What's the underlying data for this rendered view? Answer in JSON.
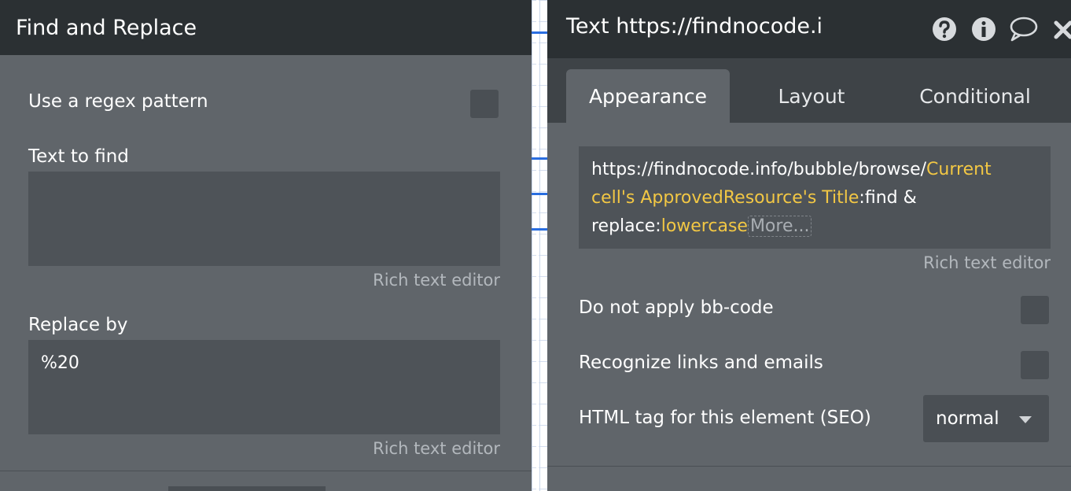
{
  "find_replace": {
    "title": "Find and Replace",
    "use_regex_label": "Use a regex pattern",
    "text_to_find_label": "Text to find",
    "text_to_find_value": "",
    "rich_text_editor_1": "Rich text editor",
    "replace_by_label": "Replace by",
    "replace_by_value": "%20",
    "rich_text_editor_2": "Rich text editor"
  },
  "element_editor": {
    "title": "Text https://findnocode.i",
    "icons": [
      "question-icon",
      "info-icon",
      "comment-icon",
      "close-icon"
    ],
    "tabs": [
      {
        "label": "Appearance",
        "active": true
      },
      {
        "label": "Layout",
        "active": false
      },
      {
        "label": "Conditional",
        "active": false
      }
    ],
    "expression": {
      "static_1": "https://findnocode.info/bubble/browse/",
      "dynamic_1": "Current cell's ApprovedResource's Title",
      "static_2": ":find & replace:",
      "dynamic_2": "lowercase",
      "more_label": "More..."
    },
    "rich_text_editor": "Rich text editor",
    "no_bbcode_label": "Do not apply bb-code",
    "recognize_links_label": "Recognize links and emails",
    "html_tag_label": "HTML tag for this element (SEO)",
    "html_tag_value": "normal"
  },
  "colors": {
    "panel_bg": "#60656a",
    "header_bg": "#2b3033",
    "dynamic_text": "#f2c744",
    "canvas_guide": "#2a6ee0"
  }
}
